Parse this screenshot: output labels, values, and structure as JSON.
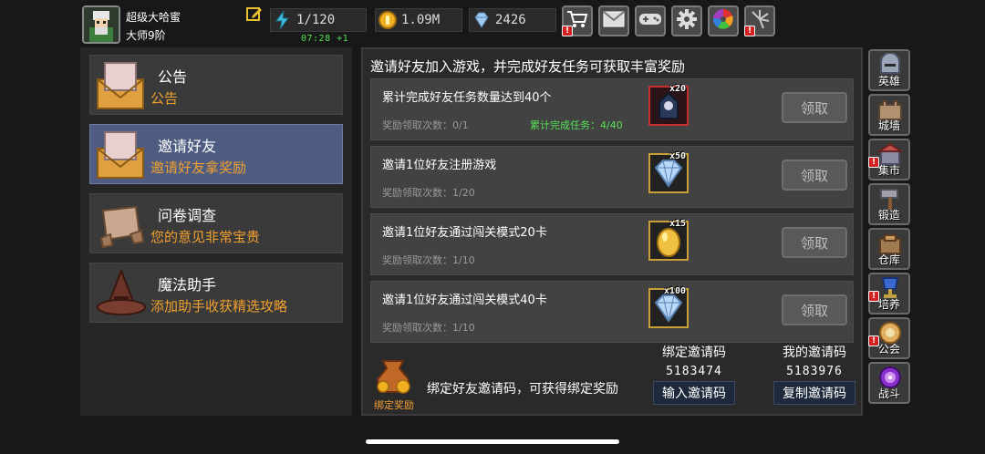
{
  "player": {
    "name": "超级大哈蜜",
    "rank": "大师9阶"
  },
  "resources": {
    "energy": "1/120",
    "energy_timer": "07:28 +1",
    "gold": "1.09M",
    "gems": "2426"
  },
  "top_buttons": [
    "shop-cart-icon",
    "mail-icon",
    "gamepad-icon",
    "gear-icon",
    "color-wheel-icon",
    "fireworks-icon"
  ],
  "left_menu": [
    {
      "title": "公告",
      "subtitle": "公告",
      "icon": "envelope-icon",
      "active": false
    },
    {
      "title": "邀请好友",
      "subtitle": "邀请好友拿奖励",
      "icon": "envelope-icon",
      "active": true
    },
    {
      "title": "问卷调查",
      "subtitle": "您的意见非常宝贵",
      "icon": "scroll-icon",
      "active": false
    },
    {
      "title": "魔法助手",
      "subtitle": "添加助手收获精选攻略",
      "icon": "witch-hat-icon",
      "active": false
    }
  ],
  "main": {
    "header": "邀请好友加入游戏，并完成好友任务可获取丰富奖励",
    "tasks": [
      {
        "title": "累计完成好友任务数量达到40个",
        "count": "奖励领取次数：0/1",
        "progress": "累计完成任务：4/40",
        "reward": "hooded-figure-icon",
        "qty": "x20",
        "claim": "领取"
      },
      {
        "title": "邀请1位好友注册游戏",
        "count": "奖励领取次数：1/20",
        "progress": "",
        "reward": "diamond-icon",
        "qty": "x50",
        "claim": "领取"
      },
      {
        "title": "邀请1位好友通过闯关模式20卡",
        "count": "奖励领取次数：1/10",
        "progress": "",
        "reward": "golden-egg-icon",
        "qty": "x15",
        "claim": "领取"
      },
      {
        "title": "邀请1位好友通过闯关模式40卡",
        "count": "奖励领取次数：1/10",
        "progress": "",
        "reward": "diamond-icon",
        "qty": "x100",
        "claim": "领取"
      }
    ],
    "bind": {
      "bag_label": "绑定奖励",
      "desc": "绑定好友邀请码，可获得绑定奖励",
      "bound_code_label": "绑定邀请码",
      "bound_code_value": "5183474",
      "input_button": "输入邀请码",
      "my_code_label": "我的邀请码",
      "my_code_value": "5183976",
      "copy_button": "复制邀请码"
    }
  },
  "sidebar": [
    {
      "label": "英雄",
      "icon": "helmet-icon",
      "alert": false
    },
    {
      "label": "城墙",
      "icon": "castle-wall-icon",
      "alert": false
    },
    {
      "label": "集市",
      "icon": "market-icon",
      "alert": true
    },
    {
      "label": "锻造",
      "icon": "hammer-icon",
      "alert": false
    },
    {
      "label": "仓库",
      "icon": "warehouse-icon",
      "alert": false
    },
    {
      "label": "培养",
      "icon": "trophy-icon",
      "alert": true
    },
    {
      "label": "公会",
      "icon": "guild-icon",
      "alert": true
    },
    {
      "label": "战斗",
      "icon": "portal-icon",
      "alert": false
    }
  ],
  "colors": {
    "accent_orange": "#f0a030",
    "accent_green": "#55e055",
    "active_blue": "#4d5c80",
    "alert_red": "#d32020"
  }
}
